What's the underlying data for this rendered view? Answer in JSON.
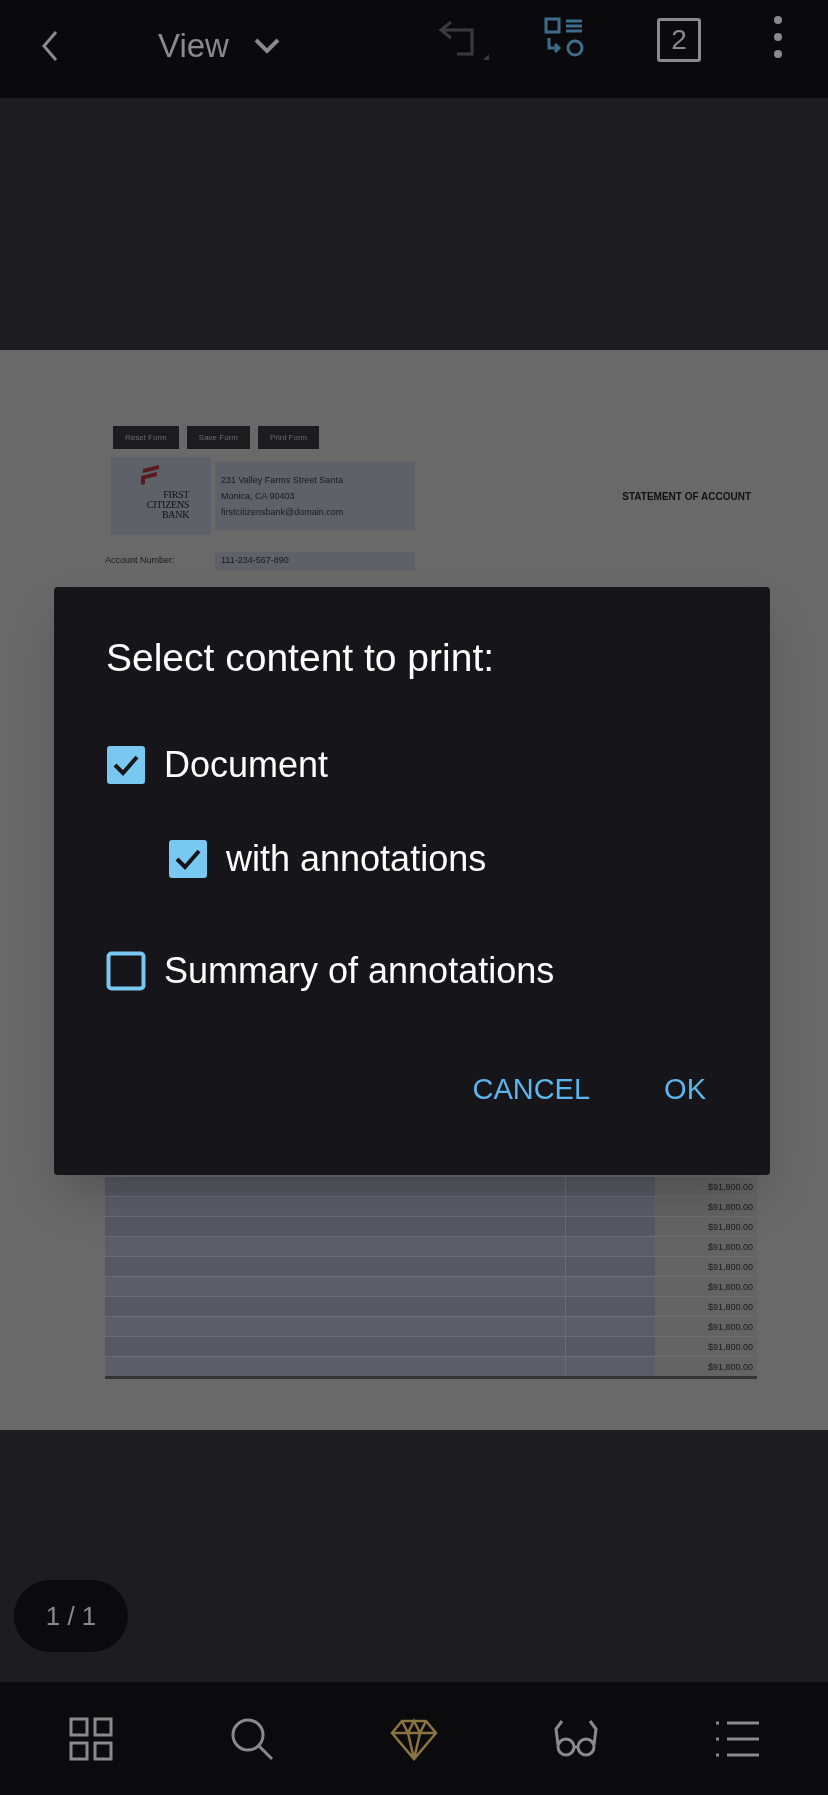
{
  "toolbar": {
    "title": "View",
    "page_count": "2"
  },
  "document": {
    "form_buttons": [
      "Reset Form",
      "Save Form",
      "Print Form"
    ],
    "bank_name_lines": [
      "FIRST",
      "CITIZENS",
      "BANK"
    ],
    "address_lines": [
      "231 Valley Farms Street Santa",
      "Monica, CA 90403",
      "firstcitizensbank@domain.com"
    ],
    "heading": "STATEMENT OF ACCOUNT",
    "fields": [
      {
        "label": "Account Number:",
        "value": "111-234-567-890"
      }
    ],
    "amounts": [
      "$91,800.00",
      "$91,800.00",
      "$91,800.00",
      "$91,800.00",
      "$91,800.00",
      "$91,800.00",
      "$91,800.00",
      "$91,800.00",
      "$91,800.00",
      "$91,800.00"
    ]
  },
  "dialog": {
    "title": "Select content to print:",
    "options": [
      {
        "label": "Document",
        "checked": true,
        "children": [
          {
            "label": "with annotations",
            "checked": true
          }
        ]
      },
      {
        "label": "Summary of annotations",
        "checked": false
      }
    ],
    "buttons": [
      "CANCEL",
      "OK"
    ]
  },
  "page_indicator": "1 / 1",
  "bottom_nav": [
    {
      "kind": "grid",
      "selected": false
    },
    {
      "kind": "search",
      "selected": false
    },
    {
      "kind": "diamond",
      "selected": true
    },
    {
      "kind": "glasses",
      "selected": false
    },
    {
      "kind": "list",
      "selected": false
    }
  ]
}
